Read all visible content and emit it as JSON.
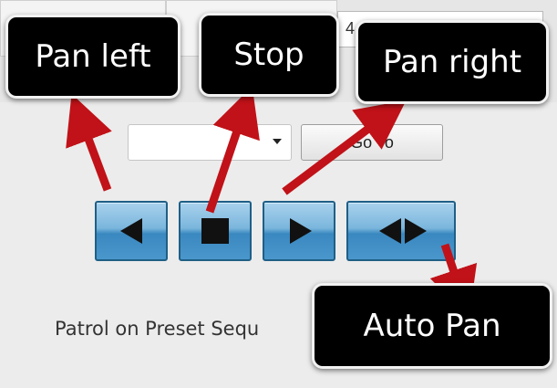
{
  "top": {
    "field_value": "4"
  },
  "preset": {
    "selected_value": "",
    "goto_label": "Go To"
  },
  "controls": [
    {
      "name": "pan-left-button",
      "icon": "arrow-left-icon"
    },
    {
      "name": "stop-button",
      "icon": "stop-icon"
    },
    {
      "name": "pan-right-button",
      "icon": "arrow-right-icon"
    },
    {
      "name": "auto-pan-button",
      "icon": "left-right-arrows-icon"
    }
  ],
  "patrol": {
    "label": "Patrol on Preset Sequ"
  },
  "callouts": {
    "pan_left": "Pan left",
    "stop": "Stop",
    "pan_right": "Pan right",
    "auto_pan": "Auto Pan"
  },
  "colors": {
    "arrow": "#c01218",
    "button_blue": "#4a97cc",
    "callout_bg": "#000000"
  }
}
